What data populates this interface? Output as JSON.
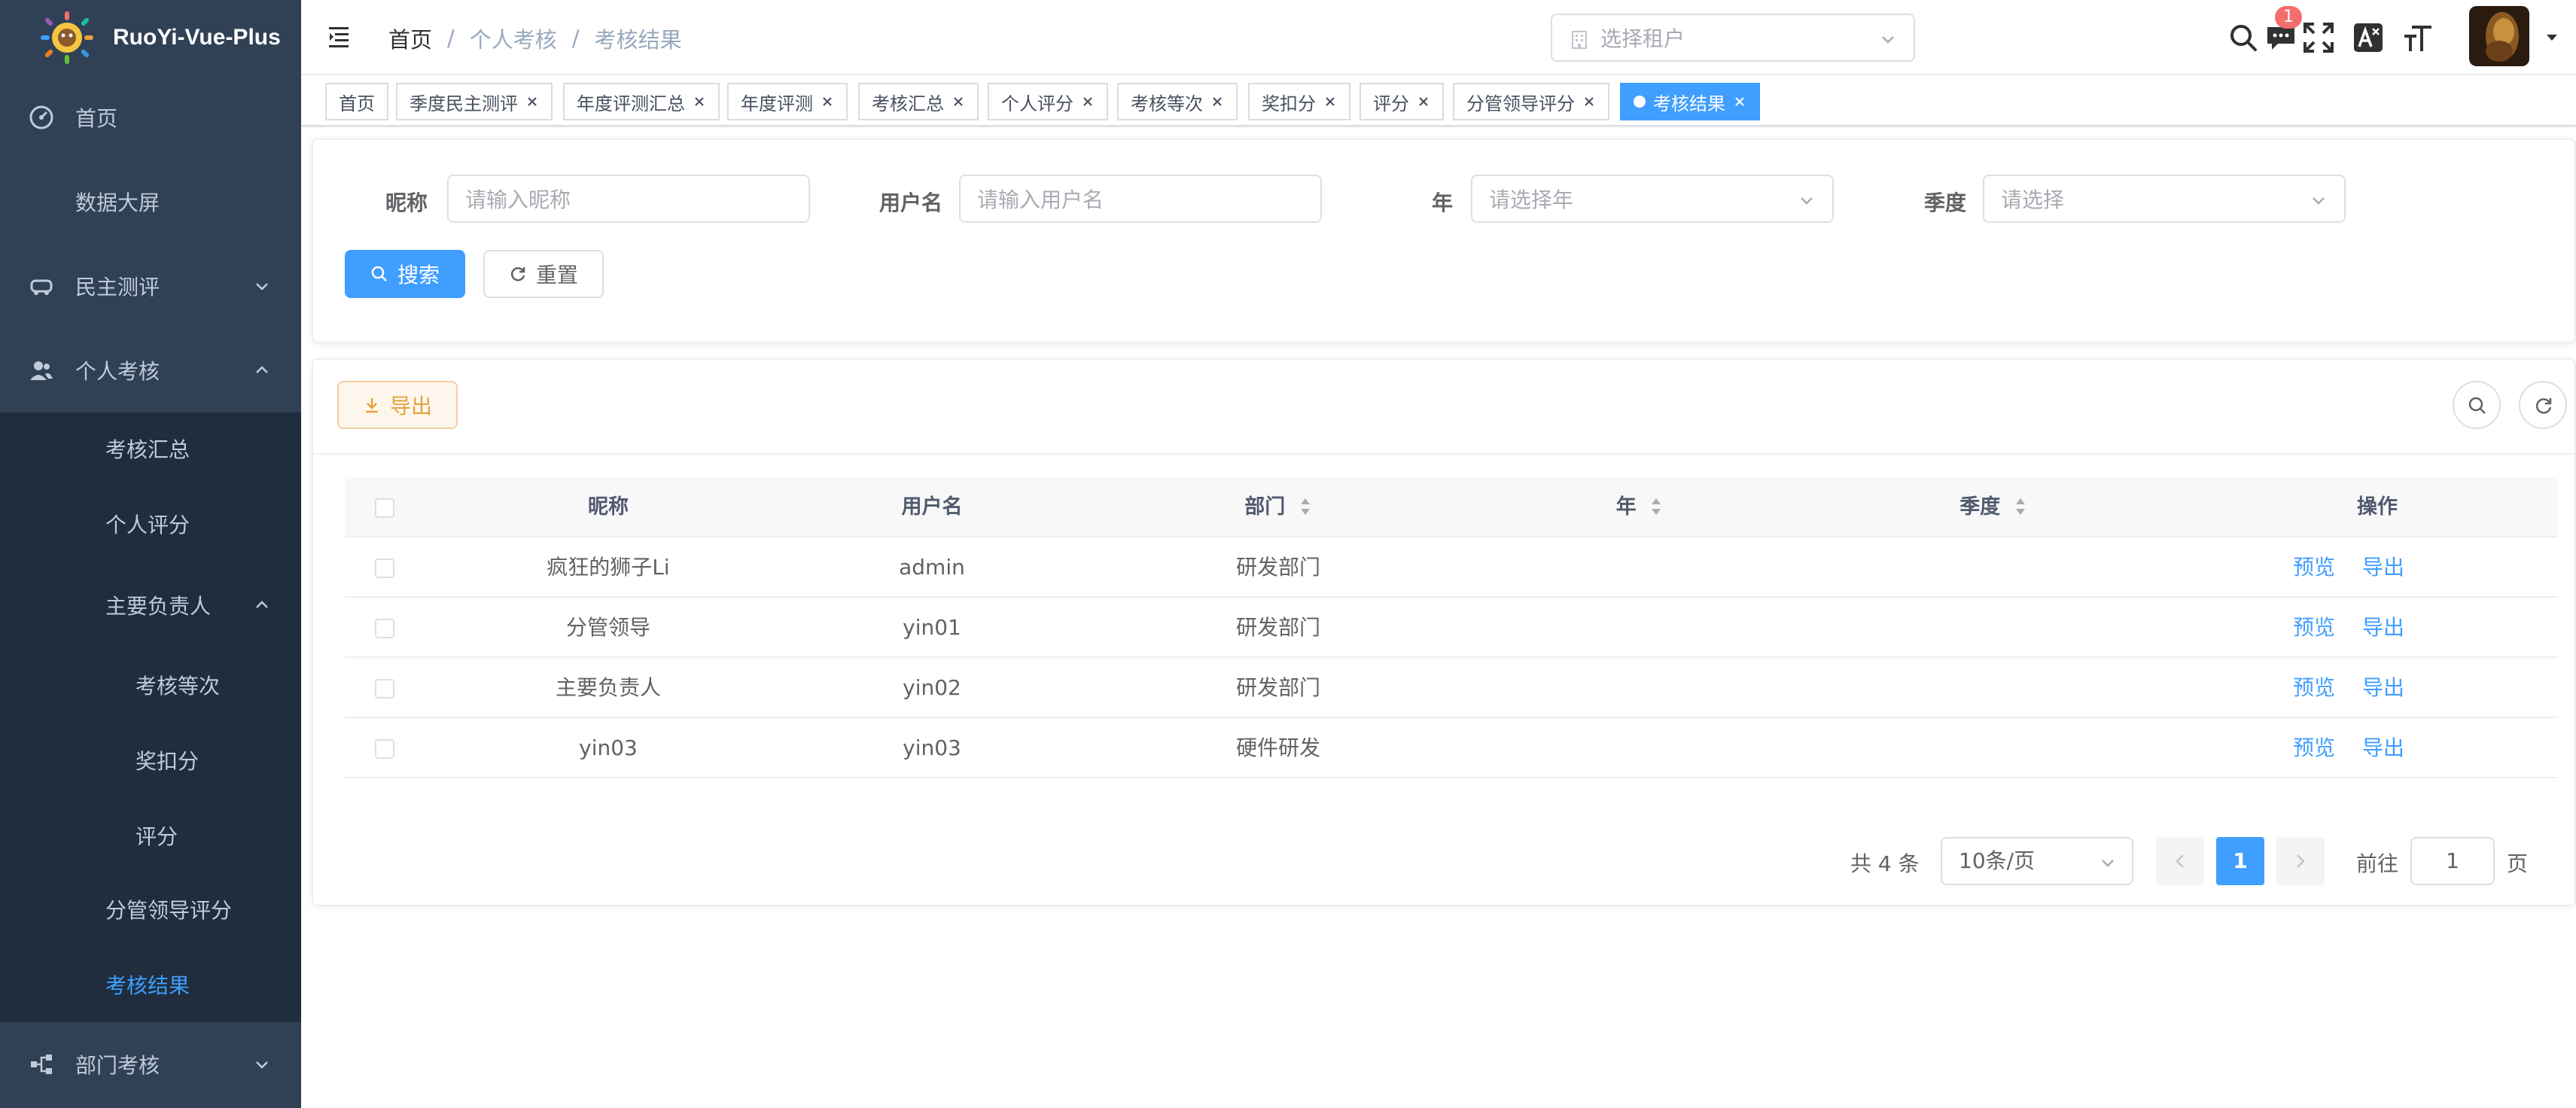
{
  "app": {
    "title": "RuoYi-Vue-Plus"
  },
  "sidebar": {
    "items": [
      {
        "label": "首页",
        "icon": "dashboard-icon"
      },
      {
        "label": "数据大屏"
      },
      {
        "label": "民主测评",
        "icon": "car-icon"
      },
      {
        "label": "个人考核",
        "icon": "peoples-icon"
      },
      {
        "label": "考核汇总"
      },
      {
        "label": "个人评分"
      },
      {
        "label": "主要负责人"
      },
      {
        "label": "考核等次"
      },
      {
        "label": "奖扣分"
      },
      {
        "label": "评分"
      },
      {
        "label": "分管领导评分"
      },
      {
        "label": "考核结果"
      },
      {
        "label": "部门考核",
        "icon": "tree-icon"
      }
    ],
    "active_color": "#409eff"
  },
  "navbar": {
    "breadcrumb": [
      "首页",
      "个人考核",
      "考核结果"
    ],
    "breadcrumb_sep": "/",
    "tenant_placeholder": "选择租户",
    "message_badge": "1"
  },
  "tags": [
    {
      "label": "首页",
      "closable": false
    },
    {
      "label": "季度民主测评",
      "closable": true
    },
    {
      "label": "年度评测汇总",
      "closable": true
    },
    {
      "label": "年度评测",
      "closable": true
    },
    {
      "label": "考核汇总",
      "closable": true
    },
    {
      "label": "个人评分",
      "closable": true
    },
    {
      "label": "考核等次",
      "closable": true
    },
    {
      "label": "奖扣分",
      "closable": true
    },
    {
      "label": "评分",
      "closable": true
    },
    {
      "label": "分管领导评分",
      "closable": true
    },
    {
      "label": "考核结果",
      "closable": true,
      "active": true
    }
  ],
  "search": {
    "nickname": {
      "label": "昵称",
      "placeholder": "请输入昵称"
    },
    "username": {
      "label": "用户名",
      "placeholder": "请输入用户名"
    },
    "year": {
      "label": "年",
      "placeholder": "请选择年"
    },
    "quarter": {
      "label": "季度",
      "placeholder": "请选择"
    },
    "search_button": "搜索",
    "reset_button": "重置"
  },
  "toolbar": {
    "export_button": "导出"
  },
  "table": {
    "columns": [
      "昵称",
      "用户名",
      "部门",
      "年",
      "季度",
      "操作"
    ],
    "rows": [
      {
        "nickname": "疯狂的狮子Li",
        "username": "admin",
        "dept": "研发部门",
        "year": "",
        "quarter": ""
      },
      {
        "nickname": "分管领导",
        "username": "yin01",
        "dept": "研发部门",
        "year": "",
        "quarter": ""
      },
      {
        "nickname": "主要负责人",
        "username": "yin02",
        "dept": "研发部门",
        "year": "",
        "quarter": ""
      },
      {
        "nickname": "yin03",
        "username": "yin03",
        "dept": "硬件研发",
        "year": "",
        "quarter": ""
      }
    ],
    "action_preview": "预览",
    "action_export": "导出"
  },
  "pagination": {
    "total_text": "共 4 条",
    "page_size": "10条/页",
    "current_page": "1",
    "goto_label": "前往",
    "goto_value": "1",
    "goto_unit": "页"
  },
  "colors": {
    "primary": "#409eff",
    "sidebar_bg": "#304156",
    "submenu_bg": "#1f2d3d",
    "warning": "#e6a23c",
    "danger": "#f56c6c"
  }
}
